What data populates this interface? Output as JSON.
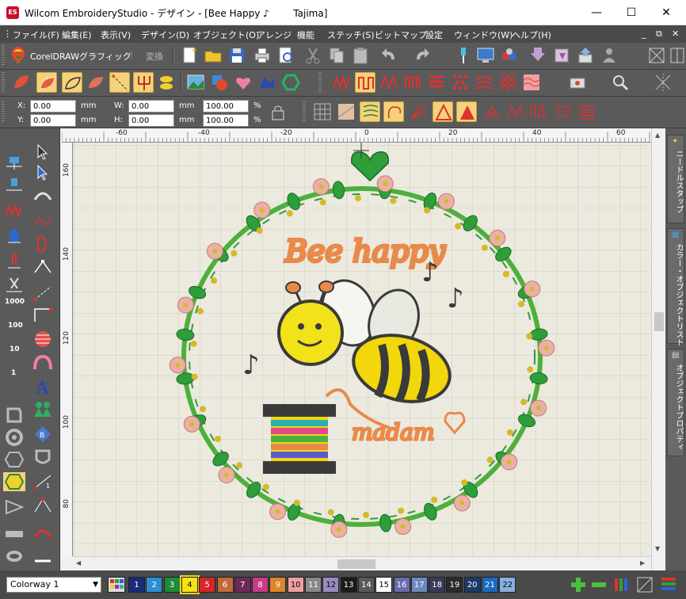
{
  "window": {
    "title": "Wilcom EmbroideryStudio - デザイン - [Bee Happy ♪        Tajima]",
    "app_badge": "ES"
  },
  "menu": {
    "items": [
      "ファイル(F)",
      "編集(E)",
      "表示(V)",
      "デザイン(D)",
      "オブジェクト(O)",
      "アレンジ",
      "機能",
      "ステッチ(S)",
      "ビットマップ",
      "設定",
      "ウィンドウ(W)",
      "ヘルプ(H)"
    ]
  },
  "toolbar": {
    "coreldraw_label": "CorelDRAWグラフィック",
    "convert_label": "変換"
  },
  "props": {
    "x_label": "X:",
    "x_value": "0.00",
    "x_unit": "mm",
    "y_label": "Y:",
    "y_value": "0.00",
    "y_unit": "mm",
    "w_label": "W:",
    "w_value": "0.00",
    "w_unit": "mm",
    "h_label": "H:",
    "h_value": "0.00",
    "h_unit": "mm",
    "sx_value": "100.00",
    "sx_unit": "%",
    "sy_value": "100.00",
    "sy_unit": "%"
  },
  "left_tools": {
    "num_1000": "1000",
    "num_100": "100",
    "num_10": "10",
    "num_1": "1"
  },
  "ruler": {
    "top_labels": [
      "-60",
      "-40",
      "-20",
      "0",
      "20",
      "40",
      "60"
    ],
    "left_labels": [
      "160",
      "140",
      "120",
      "100",
      "80"
    ]
  },
  "design": {
    "text_top": "Bee happy",
    "text_bottom": "madam",
    "colors": {
      "leaf": "#2e9e3a",
      "vine": "#4db03a",
      "flower": "#e9b1a3",
      "gold": "#d4b92a",
      "bee_body": "#f1d70b",
      "text": "#e88a4a",
      "dark": "#3a3a3a"
    }
  },
  "dock": {
    "tab1": "ニードルスタップ",
    "tab2": "カラー・オブジェクトリスト",
    "tab3": "オブジェクトプロパティ"
  },
  "status": {
    "colorway": "Colorway 1",
    "swatches": [
      {
        "n": "1",
        "c": "#1a2a7a",
        "t": "#fff"
      },
      {
        "n": "2",
        "c": "#2a8fd6",
        "t": "#fff"
      },
      {
        "n": "3",
        "c": "#1f8a3a",
        "t": "#fff"
      },
      {
        "n": "4",
        "c": "#f5e21a",
        "t": "#000"
      },
      {
        "n": "5",
        "c": "#d8242a",
        "t": "#fff"
      },
      {
        "n": "6",
        "c": "#c26a3a",
        "t": "#fff"
      },
      {
        "n": "7",
        "c": "#6a2a5a",
        "t": "#fff"
      },
      {
        "n": "8",
        "c": "#c83a8a",
        "t": "#fff"
      },
      {
        "n": "9",
        "c": "#e0842a",
        "t": "#fff"
      },
      {
        "n": "10",
        "c": "#f0a0a0",
        "t": "#000"
      },
      {
        "n": "11",
        "c": "#8a8a8a",
        "t": "#fff"
      },
      {
        "n": "12",
        "c": "#9a8ac0",
        "t": "#000"
      },
      {
        "n": "13",
        "c": "#1a1a1a",
        "t": "#fff"
      },
      {
        "n": "14",
        "c": "#5a5a5a",
        "t": "#fff"
      },
      {
        "n": "15",
        "c": "#ffffff",
        "t": "#000"
      },
      {
        "n": "16",
        "c": "#6a6ab0",
        "t": "#fff"
      },
      {
        "n": "17",
        "c": "#6a8ac0",
        "t": "#fff"
      },
      {
        "n": "18",
        "c": "#3a3a5a",
        "t": "#fff"
      },
      {
        "n": "19",
        "c": "#2a2a2a",
        "t": "#fff"
      },
      {
        "n": "20",
        "c": "#1a3a6a",
        "t": "#fff"
      },
      {
        "n": "21",
        "c": "#1a6ac0",
        "t": "#fff"
      },
      {
        "n": "22",
        "c": "#8ab0e0",
        "t": "#000"
      }
    ]
  }
}
